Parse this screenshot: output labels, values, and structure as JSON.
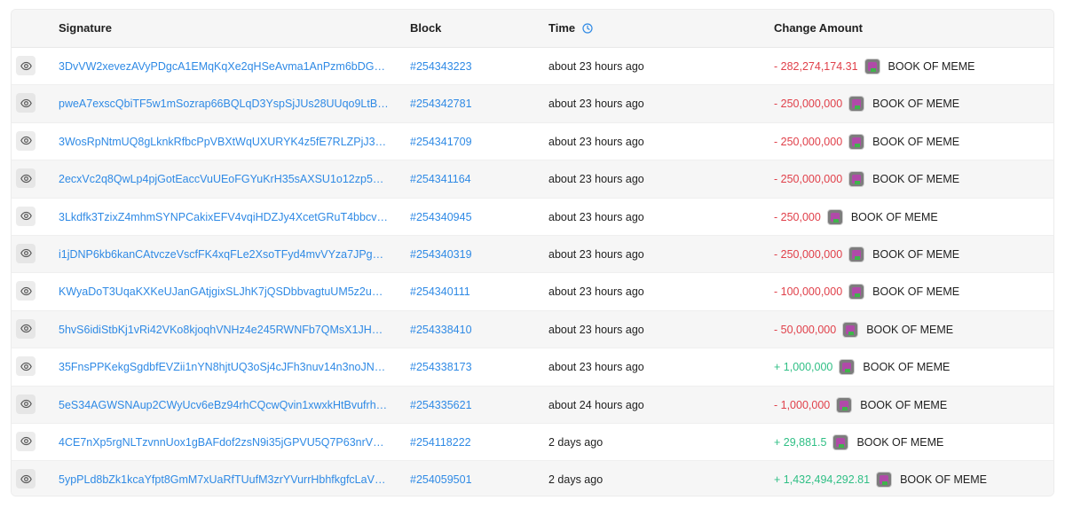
{
  "columns": {
    "signature": "Signature",
    "block": "Block",
    "time": "Time",
    "change": "Change Amount"
  },
  "colors": {
    "link": "#2f8ae5",
    "negative": "#e0404a",
    "positive": "#2fbf85"
  },
  "rows": [
    {
      "signature": "3DvVW2xevezAVyPDgcA1EMqKqXe2qHSeAvma1AnPzm6bDGTx66…",
      "block": "#254343223",
      "time": "about 23 hours ago",
      "amount": "- 282,274,174.31",
      "sign": "neg",
      "token": "BOOK OF MEME"
    },
    {
      "signature": "pweA7exscQbiTF5w1mSozrap66BQLqD3YspSjJUs28UUqo9LtBuBA…",
      "block": "#254342781",
      "time": "about 23 hours ago",
      "amount": "- 250,000,000",
      "sign": "neg",
      "token": "BOOK OF MEME"
    },
    {
      "signature": "3WosRpNtmUQ8gLknkRfbcPpVBXtWqUXURYK4z5fE7RLZPjJ3kmua…",
      "block": "#254341709",
      "time": "about 23 hours ago",
      "amount": "- 250,000,000",
      "sign": "neg",
      "token": "BOOK OF MEME"
    },
    {
      "signature": "2ecxVc2q8QwLp4pjGotEaccVuUEoFGYuKrH35sAXSU1o12zp5PrHF…",
      "block": "#254341164",
      "time": "about 23 hours ago",
      "amount": "- 250,000,000",
      "sign": "neg",
      "token": "BOOK OF MEME"
    },
    {
      "signature": "3Lkdfk3TzixZ4mhmSYNPCakixEFV4vqiHDZJy4XcetGRuT4bbcvJsed…",
      "block": "#254340945",
      "time": "about 23 hours ago",
      "amount": "- 250,000",
      "sign": "neg",
      "token": "BOOK OF MEME"
    },
    {
      "signature": "i1jDNP6kb6kanCAtvczeVscfFK4xqFLe2XsoTFyd4mvVYza7JPgnqAr…",
      "block": "#254340319",
      "time": "about 23 hours ago",
      "amount": "- 250,000,000",
      "sign": "neg",
      "token": "BOOK OF MEME"
    },
    {
      "signature": "KWyaDoT3UqaKXKeUJanGAtjgixSLJhK7jQSDbbvagtuUM5z2uVyKvj…",
      "block": "#254340111",
      "time": "about 23 hours ago",
      "amount": "- 100,000,000",
      "sign": "neg",
      "token": "BOOK OF MEME"
    },
    {
      "signature": "5hvS6idiStbKj1vRi42VKo8kjoqhVNHz4e245RWNFb7QMsX1JHhyUA…",
      "block": "#254338410",
      "time": "about 23 hours ago",
      "amount": "- 50,000,000",
      "sign": "neg",
      "token": "BOOK OF MEME"
    },
    {
      "signature": "35FnsPPKekgSgdbfEVZii1nYN8hjtUQ3oSj4cJFh3nuv14n3noJNUu5…",
      "block": "#254338173",
      "time": "about 23 hours ago",
      "amount": "+ 1,000,000",
      "sign": "pos",
      "token": "BOOK OF MEME"
    },
    {
      "signature": "5eS34AGWSNAup2CWyUcv6eBz94rhCQcwQvin1xwxkHtBvufrhan3x…",
      "block": "#254335621",
      "time": "about 24 hours ago",
      "amount": "- 1,000,000",
      "sign": "neg",
      "token": "BOOK OF MEME"
    },
    {
      "signature": "4CE7nXp5rgNLTzvnnUox1gBAFdof2zsN9i35jGPVU5Q7P63nrV6b2P…",
      "block": "#254118222",
      "time": "2 days ago",
      "amount": "+ 29,881.5",
      "sign": "pos",
      "token": "BOOK OF MEME"
    },
    {
      "signature": "5ypPLd8bZk1kcaYfpt8GmM7xUaRfTUufM3zrYVurrHbhfkgfcLaVcas…",
      "block": "#254059501",
      "time": "2 days ago",
      "amount": "+ 1,432,494,292.81",
      "sign": "pos",
      "token": "BOOK OF MEME"
    }
  ]
}
